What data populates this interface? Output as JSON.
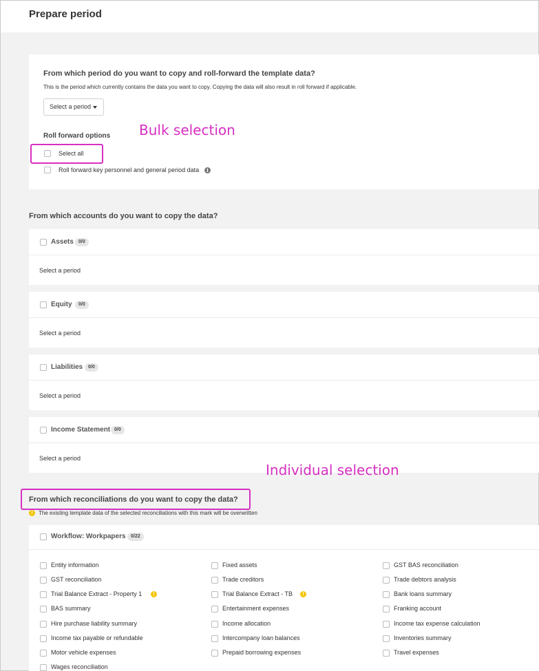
{
  "header": {
    "title": "Prepare period"
  },
  "period_section": {
    "question": "From which period do you want to copy and roll-forward the template data?",
    "subtitle": "This is the period which currently contains the data you want to copy. Copying the data will also result in roll forward if applicable.",
    "select_label": "Select a period",
    "roll_forward_heading": "Roll forward options",
    "options": [
      {
        "label": "Select all",
        "checked": false
      },
      {
        "label": "Roll forward key personnel and general period data",
        "checked": false
      }
    ]
  },
  "annotations": {
    "bulk": "Bulk selection",
    "individual": "Individual selection",
    "color": "#d62fc0"
  },
  "accounts_section": {
    "title": "From which accounts do you want to copy the data?",
    "groups": [
      {
        "name": "Assets",
        "count": "0/0",
        "body": "Select a period"
      },
      {
        "name": "Equity",
        "count": "0/0",
        "body": "Select a period"
      },
      {
        "name": "Liabilities",
        "count": "0/0",
        "body": "Select a period"
      },
      {
        "name": "Income Statement",
        "count": "0/0",
        "body": "Select a period"
      }
    ]
  },
  "reconciliations_section": {
    "title": "From which reconciliations do you want to copy the data?",
    "warning_note": "The existing template data of the selected reconciliations with this mark will be overwritten",
    "workflow": {
      "title": "Workflow: Workpapers",
      "count": "0/22",
      "items": [
        {
          "label": "Entity information",
          "warn": false
        },
        {
          "label": "Fixed assets",
          "warn": false
        },
        {
          "label": "GST BAS reconciliation",
          "warn": false
        },
        {
          "label": "GST reconciliation",
          "warn": false
        },
        {
          "label": "Trade creditors",
          "warn": false
        },
        {
          "label": "Trade debtors analysis",
          "warn": false
        },
        {
          "label": "Trial Balance Extract - Property 1",
          "warn": true
        },
        {
          "label": "Trial Balance Extract - TB",
          "warn": true
        },
        {
          "label": "Bank loans summary",
          "warn": false
        },
        {
          "label": "BAS summary",
          "warn": false
        },
        {
          "label": "Entertainment expenses",
          "warn": false
        },
        {
          "label": "Franking account",
          "warn": false
        },
        {
          "label": "Hire purchase liability summary",
          "warn": false
        },
        {
          "label": "Income allocation",
          "warn": false
        },
        {
          "label": "Income tax expense calculation",
          "warn": false
        },
        {
          "label": "Income tax payable or refundable",
          "warn": false
        },
        {
          "label": "Intercompany loan balances",
          "warn": false
        },
        {
          "label": "Inventories summary",
          "warn": false
        },
        {
          "label": "Motor vehicle expenses",
          "warn": false
        },
        {
          "label": "Prepaid borrowing expenses",
          "warn": false
        },
        {
          "label": "Travel expenses",
          "warn": false
        },
        {
          "label": "Wages reconciliation",
          "warn": false
        }
      ]
    }
  },
  "icons": {
    "info": "info-icon",
    "warning": "warning-icon",
    "caret": "caret-down-icon"
  }
}
